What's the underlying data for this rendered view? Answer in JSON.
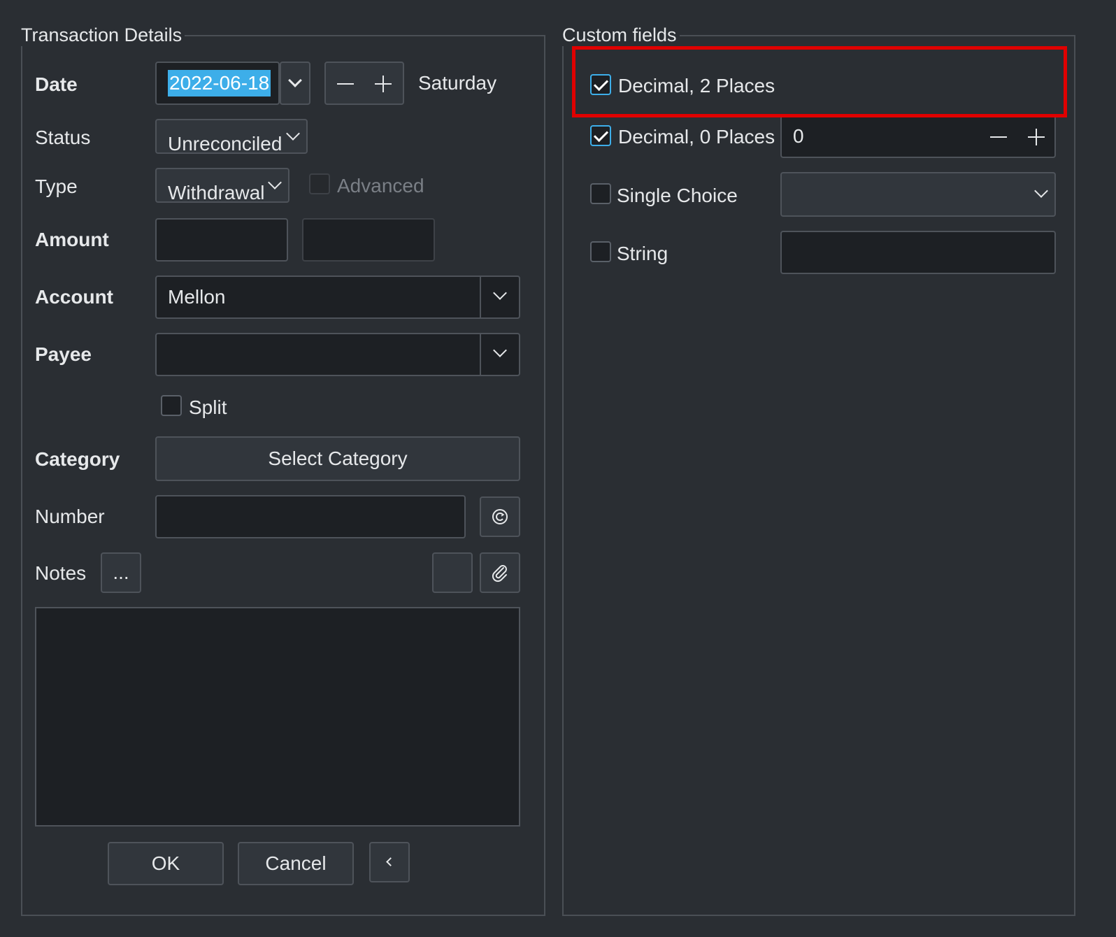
{
  "transaction": {
    "legend": "Transaction Details",
    "date": {
      "label": "Date",
      "value": "2022-06-18",
      "weekday": "Saturday"
    },
    "status": {
      "label": "Status",
      "value": "Unreconciled"
    },
    "type": {
      "label": "Type",
      "value": "Withdrawal",
      "advanced_label": "Advanced"
    },
    "amount": {
      "label": "Amount",
      "value1": "",
      "value2": ""
    },
    "account": {
      "label": "Account",
      "value": "Mellon"
    },
    "payee": {
      "label": "Payee",
      "value": ""
    },
    "split": {
      "label": "Split",
      "checked": false
    },
    "category": {
      "label": "Category",
      "button": "Select Category"
    },
    "number": {
      "label": "Number",
      "value": ""
    },
    "notes": {
      "label": "Notes",
      "more_button": "...",
      "value": ""
    },
    "buttons": {
      "ok": "OK",
      "cancel": "Cancel"
    }
  },
  "custom_fields": {
    "legend": "Custom fields",
    "items": [
      {
        "label": "Decimal, 2 Places",
        "checked": true
      },
      {
        "label": "Decimal, 0 Places",
        "checked": true,
        "value": "0"
      },
      {
        "label": "Single Choice",
        "checked": false,
        "value": ""
      },
      {
        "label": "String",
        "checked": false,
        "value": ""
      }
    ]
  },
  "colors": {
    "background": "#2a2e33",
    "field": "#1d2024",
    "selection": "#3daee9",
    "highlight_box": "#e00000"
  },
  "icons": [
    "chevron-down-icon",
    "minus-icon",
    "plus-icon",
    "refresh-icon",
    "paperclip-icon",
    "chevron-left-icon"
  ]
}
